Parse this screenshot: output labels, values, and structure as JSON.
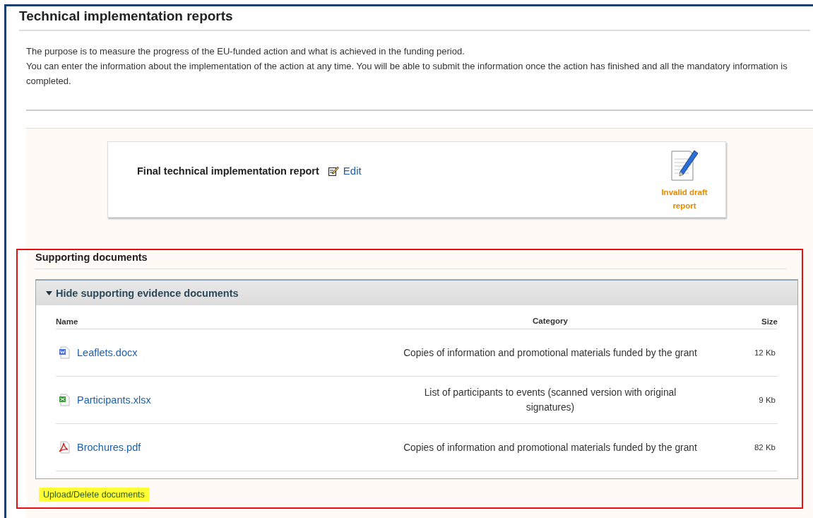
{
  "page": {
    "title": "Technical implementation reports"
  },
  "intro": [
    "The purpose is to measure the progress of the EU-funded action and what is achieved in the funding period.",
    "You can enter the information about the implementation of the action at any time. You will be able to submit the information once the action has finished and all the mandatory information is completed."
  ],
  "report": {
    "title": "Final technical implementation report",
    "edit_link": "Edit",
    "status": "Invalid draft report"
  },
  "supporting_documents": {
    "heading": "Supporting documents",
    "toggle": {
      "label": "Hide supporting evidence documents",
      "expanded": true
    },
    "table": {
      "columns": [
        "Name",
        "Category",
        "Size"
      ],
      "rows": [
        {
          "kind": "docx",
          "name": "Leaflets.docx",
          "category": "Copies of information and promotional materials funded by the grant",
          "size": "12 Kb"
        },
        {
          "kind": "xlsx",
          "name": "Participants.xlsx",
          "category": "List of participants to events (scanned version with original signatures)",
          "size": "9 Kb"
        },
        {
          "kind": "pdf",
          "name": "Brochures.pdf",
          "category": "Copies of information and promotional materials funded by the grant",
          "size": "82 Kb"
        }
      ]
    },
    "upload_link": {
      "label": "Upload/Delete documents",
      "highlighted": true
    }
  }
}
